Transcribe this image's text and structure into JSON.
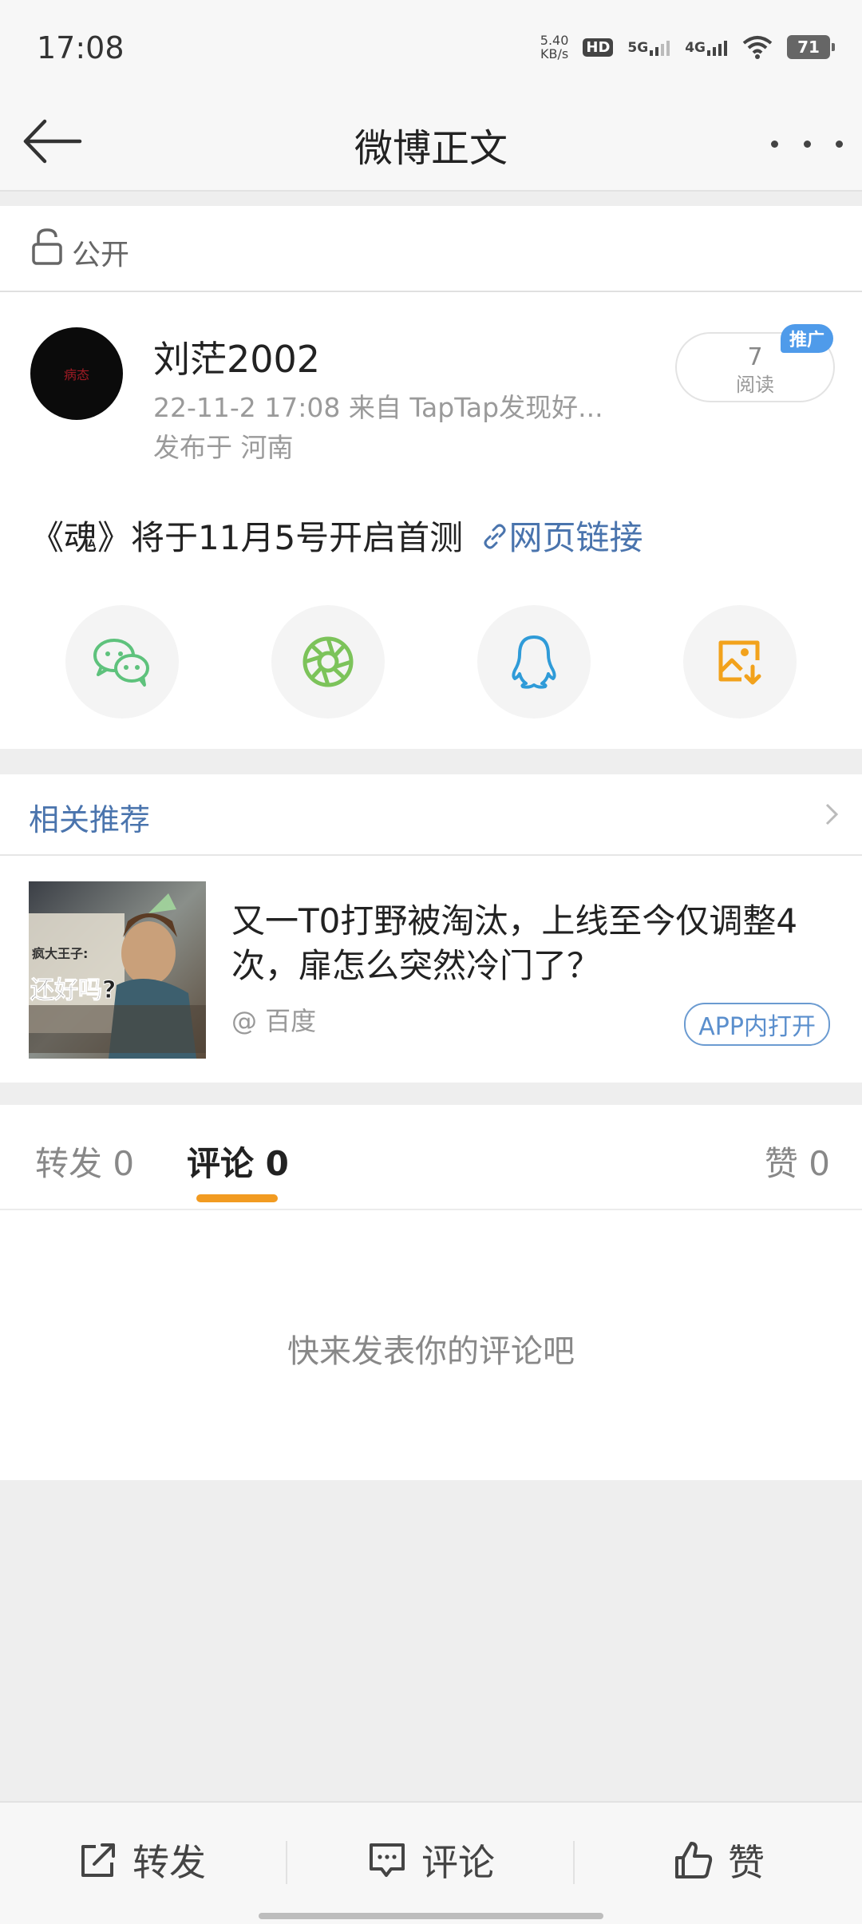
{
  "status_bar": {
    "time": "17:08",
    "net_speed": "5.40",
    "net_speed_unit": "KB/s",
    "hd_label": "HD",
    "sim1_label": "5G",
    "sim2_label": "4G",
    "battery": "71"
  },
  "nav": {
    "title": "微博正文"
  },
  "visibility": {
    "label": "公开"
  },
  "post": {
    "author": "刘茫2002",
    "avatar_text": "病态",
    "meta": "22-11-2 17:08   来自 TapTap发现好...",
    "location": "发布于 河南",
    "read_count": "7",
    "read_label": "阅读",
    "promo_badge": "推广",
    "text": "《魂》将于11月5号开启首测",
    "link_label": "网页链接"
  },
  "share_icons": [
    "wechat-icon",
    "moments-icon",
    "qq-icon",
    "save-image-icon"
  ],
  "related": {
    "title": "相关推荐",
    "article": {
      "title": "又一T0打野被淘汰，上线至今仅调整4次，扉怎么突然冷门了？",
      "source": "@ 百度",
      "open_button": "APP内打开",
      "thumb_text_top": "疯大王子:",
      "thumb_text_main": "还好吗?"
    }
  },
  "tabs": {
    "repost": "转发 0",
    "comment": "评论 0",
    "like": "赞 0"
  },
  "comments": {
    "empty": "快来发表你的评论吧"
  },
  "bottom": {
    "repost": "转发",
    "comment": "评论",
    "like": "赞"
  },
  "colors": {
    "link_blue": "#4a74ad",
    "tab_underline": "#f29b21",
    "promo_blue": "#4f9bea",
    "wechat_green": "#5ec27c",
    "moments_green": "#7cc35a",
    "qq_blue": "#2f9bd8",
    "save_orange": "#f2a21c"
  }
}
